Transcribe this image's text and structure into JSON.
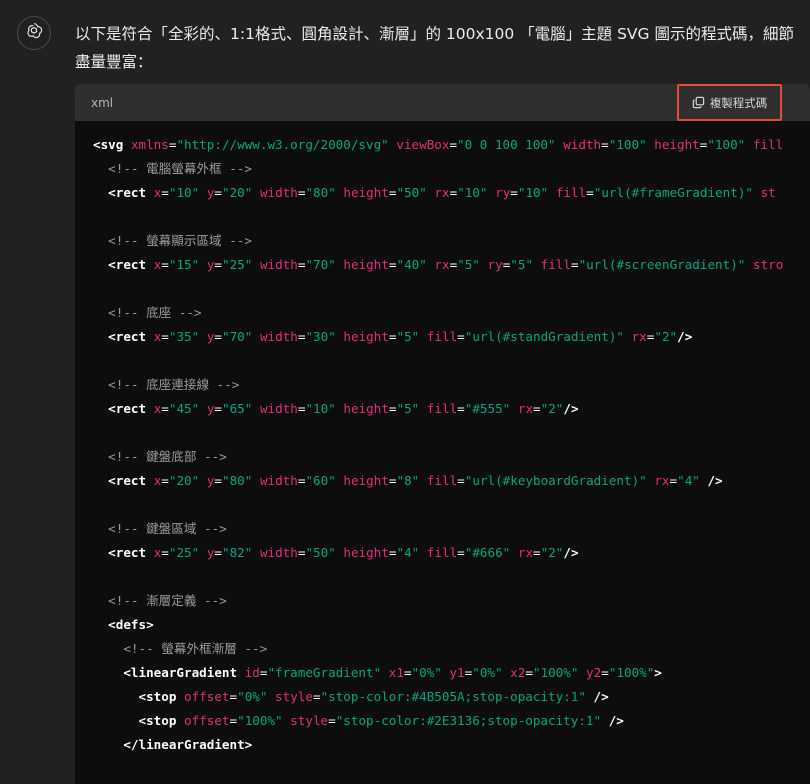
{
  "message": {
    "text": "以下是符合「全彩的、1:1格式、圓角設計、漸層」的 100x100 「電腦」主題 SVG 圖示的程式碼，細節盡量豐富："
  },
  "code_block": {
    "language": "xml",
    "copy_label": "複製程式碼",
    "lines": [
      [
        [
          "tag",
          "<svg"
        ],
        [
          "text",
          " "
        ],
        [
          "attr",
          "xmlns"
        ],
        [
          "punct",
          "="
        ],
        [
          "val",
          "\"http://www.w3.org/2000/svg\""
        ],
        [
          "text",
          " "
        ],
        [
          "attr",
          "viewBox"
        ],
        [
          "punct",
          "="
        ],
        [
          "val",
          "\"0 0 100 100\""
        ],
        [
          "text",
          " "
        ],
        [
          "attr",
          "width"
        ],
        [
          "punct",
          "="
        ],
        [
          "val",
          "\"100\""
        ],
        [
          "text",
          " "
        ],
        [
          "attr",
          "height"
        ],
        [
          "punct",
          "="
        ],
        [
          "val",
          "\"100\""
        ],
        [
          "text",
          " "
        ],
        [
          "attr",
          "fill"
        ]
      ],
      [
        [
          "text",
          "  "
        ],
        [
          "comment",
          "<!-- 電腦螢幕外框 -->"
        ]
      ],
      [
        [
          "text",
          "  "
        ],
        [
          "tag",
          "<rect"
        ],
        [
          "text",
          " "
        ],
        [
          "attr",
          "x"
        ],
        [
          "punct",
          "="
        ],
        [
          "val",
          "\"10\""
        ],
        [
          "text",
          " "
        ],
        [
          "attr",
          "y"
        ],
        [
          "punct",
          "="
        ],
        [
          "val",
          "\"20\""
        ],
        [
          "text",
          " "
        ],
        [
          "attr",
          "width"
        ],
        [
          "punct",
          "="
        ],
        [
          "val",
          "\"80\""
        ],
        [
          "text",
          " "
        ],
        [
          "attr",
          "height"
        ],
        [
          "punct",
          "="
        ],
        [
          "val",
          "\"50\""
        ],
        [
          "text",
          " "
        ],
        [
          "attr",
          "rx"
        ],
        [
          "punct",
          "="
        ],
        [
          "val",
          "\"10\""
        ],
        [
          "text",
          " "
        ],
        [
          "attr",
          "ry"
        ],
        [
          "punct",
          "="
        ],
        [
          "val",
          "\"10\""
        ],
        [
          "text",
          " "
        ],
        [
          "attr",
          "fill"
        ],
        [
          "punct",
          "="
        ],
        [
          "val",
          "\"url(#frameGradient)\""
        ],
        [
          "text",
          " "
        ],
        [
          "attr",
          "st"
        ]
      ],
      [],
      [
        [
          "text",
          "  "
        ],
        [
          "comment",
          "<!-- 螢幕顯示區域 -->"
        ]
      ],
      [
        [
          "text",
          "  "
        ],
        [
          "tag",
          "<rect"
        ],
        [
          "text",
          " "
        ],
        [
          "attr",
          "x"
        ],
        [
          "punct",
          "="
        ],
        [
          "val",
          "\"15\""
        ],
        [
          "text",
          " "
        ],
        [
          "attr",
          "y"
        ],
        [
          "punct",
          "="
        ],
        [
          "val",
          "\"25\""
        ],
        [
          "text",
          " "
        ],
        [
          "attr",
          "width"
        ],
        [
          "punct",
          "="
        ],
        [
          "val",
          "\"70\""
        ],
        [
          "text",
          " "
        ],
        [
          "attr",
          "height"
        ],
        [
          "punct",
          "="
        ],
        [
          "val",
          "\"40\""
        ],
        [
          "text",
          " "
        ],
        [
          "attr",
          "rx"
        ],
        [
          "punct",
          "="
        ],
        [
          "val",
          "\"5\""
        ],
        [
          "text",
          " "
        ],
        [
          "attr",
          "ry"
        ],
        [
          "punct",
          "="
        ],
        [
          "val",
          "\"5\""
        ],
        [
          "text",
          " "
        ],
        [
          "attr",
          "fill"
        ],
        [
          "punct",
          "="
        ],
        [
          "val",
          "\"url(#screenGradient)\""
        ],
        [
          "text",
          " "
        ],
        [
          "attr",
          "stro"
        ]
      ],
      [],
      [
        [
          "text",
          "  "
        ],
        [
          "comment",
          "<!-- 底座 -->"
        ]
      ],
      [
        [
          "text",
          "  "
        ],
        [
          "tag",
          "<rect"
        ],
        [
          "text",
          " "
        ],
        [
          "attr",
          "x"
        ],
        [
          "punct",
          "="
        ],
        [
          "val",
          "\"35\""
        ],
        [
          "text",
          " "
        ],
        [
          "attr",
          "y"
        ],
        [
          "punct",
          "="
        ],
        [
          "val",
          "\"70\""
        ],
        [
          "text",
          " "
        ],
        [
          "attr",
          "width"
        ],
        [
          "punct",
          "="
        ],
        [
          "val",
          "\"30\""
        ],
        [
          "text",
          " "
        ],
        [
          "attr",
          "height"
        ],
        [
          "punct",
          "="
        ],
        [
          "val",
          "\"5\""
        ],
        [
          "text",
          " "
        ],
        [
          "attr",
          "fill"
        ],
        [
          "punct",
          "="
        ],
        [
          "val",
          "\"url(#standGradient)\""
        ],
        [
          "text",
          " "
        ],
        [
          "attr",
          "rx"
        ],
        [
          "punct",
          "="
        ],
        [
          "val",
          "\"2\""
        ],
        [
          "tag",
          "/>"
        ]
      ],
      [],
      [
        [
          "text",
          "  "
        ],
        [
          "comment",
          "<!-- 底座連接線 -->"
        ]
      ],
      [
        [
          "text",
          "  "
        ],
        [
          "tag",
          "<rect"
        ],
        [
          "text",
          " "
        ],
        [
          "attr",
          "x"
        ],
        [
          "punct",
          "="
        ],
        [
          "val",
          "\"45\""
        ],
        [
          "text",
          " "
        ],
        [
          "attr",
          "y"
        ],
        [
          "punct",
          "="
        ],
        [
          "val",
          "\"65\""
        ],
        [
          "text",
          " "
        ],
        [
          "attr",
          "width"
        ],
        [
          "punct",
          "="
        ],
        [
          "val",
          "\"10\""
        ],
        [
          "text",
          " "
        ],
        [
          "attr",
          "height"
        ],
        [
          "punct",
          "="
        ],
        [
          "val",
          "\"5\""
        ],
        [
          "text",
          " "
        ],
        [
          "attr",
          "fill"
        ],
        [
          "punct",
          "="
        ],
        [
          "val",
          "\"#555\""
        ],
        [
          "text",
          " "
        ],
        [
          "attr",
          "rx"
        ],
        [
          "punct",
          "="
        ],
        [
          "val",
          "\"2\""
        ],
        [
          "tag",
          "/>"
        ]
      ],
      [],
      [
        [
          "text",
          "  "
        ],
        [
          "comment",
          "<!-- 鍵盤底部 -->"
        ]
      ],
      [
        [
          "text",
          "  "
        ],
        [
          "tag",
          "<rect"
        ],
        [
          "text",
          " "
        ],
        [
          "attr",
          "x"
        ],
        [
          "punct",
          "="
        ],
        [
          "val",
          "\"20\""
        ],
        [
          "text",
          " "
        ],
        [
          "attr",
          "y"
        ],
        [
          "punct",
          "="
        ],
        [
          "val",
          "\"80\""
        ],
        [
          "text",
          " "
        ],
        [
          "attr",
          "width"
        ],
        [
          "punct",
          "="
        ],
        [
          "val",
          "\"60\""
        ],
        [
          "text",
          " "
        ],
        [
          "attr",
          "height"
        ],
        [
          "punct",
          "="
        ],
        [
          "val",
          "\"8\""
        ],
        [
          "text",
          " "
        ],
        [
          "attr",
          "fill"
        ],
        [
          "punct",
          "="
        ],
        [
          "val",
          "\"url(#keyboardGradient)\""
        ],
        [
          "text",
          " "
        ],
        [
          "attr",
          "rx"
        ],
        [
          "punct",
          "="
        ],
        [
          "val",
          "\"4\""
        ],
        [
          "text",
          " "
        ],
        [
          "tag",
          "/>"
        ]
      ],
      [],
      [
        [
          "text",
          "  "
        ],
        [
          "comment",
          "<!-- 鍵盤區域 -->"
        ]
      ],
      [
        [
          "text",
          "  "
        ],
        [
          "tag",
          "<rect"
        ],
        [
          "text",
          " "
        ],
        [
          "attr",
          "x"
        ],
        [
          "punct",
          "="
        ],
        [
          "val",
          "\"25\""
        ],
        [
          "text",
          " "
        ],
        [
          "attr",
          "y"
        ],
        [
          "punct",
          "="
        ],
        [
          "val",
          "\"82\""
        ],
        [
          "text",
          " "
        ],
        [
          "attr",
          "width"
        ],
        [
          "punct",
          "="
        ],
        [
          "val",
          "\"50\""
        ],
        [
          "text",
          " "
        ],
        [
          "attr",
          "height"
        ],
        [
          "punct",
          "="
        ],
        [
          "val",
          "\"4\""
        ],
        [
          "text",
          " "
        ],
        [
          "attr",
          "fill"
        ],
        [
          "punct",
          "="
        ],
        [
          "val",
          "\"#666\""
        ],
        [
          "text",
          " "
        ],
        [
          "attr",
          "rx"
        ],
        [
          "punct",
          "="
        ],
        [
          "val",
          "\"2\""
        ],
        [
          "tag",
          "/>"
        ]
      ],
      [],
      [
        [
          "text",
          "  "
        ],
        [
          "comment",
          "<!-- 漸層定義 -->"
        ]
      ],
      [
        [
          "text",
          "  "
        ],
        [
          "tag",
          "<defs>"
        ]
      ],
      [
        [
          "text",
          "    "
        ],
        [
          "comment",
          "<!-- 螢幕外框漸層 -->"
        ]
      ],
      [
        [
          "text",
          "    "
        ],
        [
          "tag",
          "<linearGradient"
        ],
        [
          "text",
          " "
        ],
        [
          "attr",
          "id"
        ],
        [
          "punct",
          "="
        ],
        [
          "val",
          "\"frameGradient\""
        ],
        [
          "text",
          " "
        ],
        [
          "attr",
          "x1"
        ],
        [
          "punct",
          "="
        ],
        [
          "val",
          "\"0%\""
        ],
        [
          "text",
          " "
        ],
        [
          "attr",
          "y1"
        ],
        [
          "punct",
          "="
        ],
        [
          "val",
          "\"0%\""
        ],
        [
          "text",
          " "
        ],
        [
          "attr",
          "x2"
        ],
        [
          "punct",
          "="
        ],
        [
          "val",
          "\"100%\""
        ],
        [
          "text",
          " "
        ],
        [
          "attr",
          "y2"
        ],
        [
          "punct",
          "="
        ],
        [
          "val",
          "\"100%\""
        ],
        [
          "tag",
          ">"
        ]
      ],
      [
        [
          "text",
          "      "
        ],
        [
          "tag",
          "<stop"
        ],
        [
          "text",
          " "
        ],
        [
          "attr",
          "offset"
        ],
        [
          "punct",
          "="
        ],
        [
          "val",
          "\"0%\""
        ],
        [
          "text",
          " "
        ],
        [
          "attr",
          "style"
        ],
        [
          "punct",
          "="
        ],
        [
          "val",
          "\"stop-color:#4B505A;stop-opacity:1\""
        ],
        [
          "text",
          " "
        ],
        [
          "tag",
          "/>"
        ]
      ],
      [
        [
          "text",
          "      "
        ],
        [
          "tag",
          "<stop"
        ],
        [
          "text",
          " "
        ],
        [
          "attr",
          "offset"
        ],
        [
          "punct",
          "="
        ],
        [
          "val",
          "\"100%\""
        ],
        [
          "text",
          " "
        ],
        [
          "attr",
          "style"
        ],
        [
          "punct",
          "="
        ],
        [
          "val",
          "\"stop-color:#2E3136;stop-opacity:1\""
        ],
        [
          "text",
          " "
        ],
        [
          "tag",
          "/>"
        ]
      ],
      [
        [
          "text",
          "    "
        ],
        [
          "tag",
          "</linearGradient>"
        ]
      ]
    ]
  }
}
